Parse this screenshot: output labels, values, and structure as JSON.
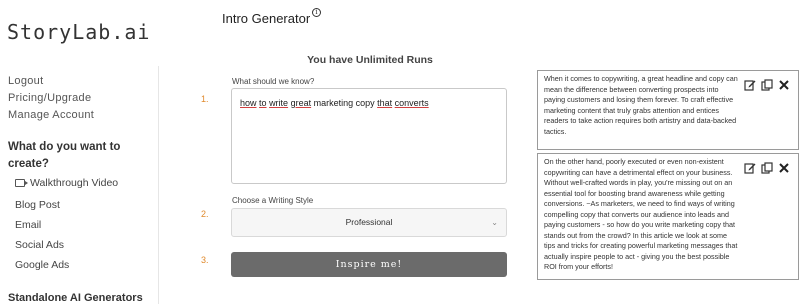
{
  "app": {
    "logo": "StoryLab.ai"
  },
  "sidebar": {
    "links": [
      "Logout",
      "Pricing/Upgrade",
      "Manage Account"
    ],
    "heading": "What do you want to create?",
    "items": [
      "Walkthrough Video",
      "Blog Post",
      "Email",
      "Social Ads",
      "Google Ads"
    ],
    "bottom_heading": "Standalone AI Generators"
  },
  "header": {
    "title": "Intro Generator",
    "info_icon": "i"
  },
  "runs_banner": "You have Unlimited Runs",
  "form": {
    "step1": "1.",
    "topic_label": "What should we know?",
    "topic_words": [
      "how",
      " ",
      "to",
      " ",
      "write",
      " ",
      "great",
      " marketing copy ",
      "that",
      " ",
      "converts"
    ],
    "step2": "2.",
    "style_label": "Choose a Writing Style",
    "style_value": "Professional",
    "step3": "3.",
    "submit_label": "Inspire me!"
  },
  "outputs": [
    {
      "text": "When it comes to copywriting, a great headline and copy can mean the difference between converting prospects into paying customers and losing them forever. To craft effective marketing content that truly grabs attention and entices readers to take action requires both artistry and data-backed tactics."
    },
    {
      "text": "On the other hand, poorly executed or even non-existent copywriting can have a detrimental effect on your business. Without well-crafted words in play, you're missing out on an essential tool for boosting brand awareness while getting conversions. ~As marketers, we need to find ways of writing compelling copy that converts our audience into leads and paying customers - so how do you write marketing copy that stands out from the crowd? In this article we look at some tips and tricks for creating powerful marketing messages that actually inspire people to act - giving you the best possible ROI from your efforts!"
    }
  ],
  "colors": {
    "accent_step": "#e08a2c",
    "button_bg": "#6b6b6b"
  },
  "icons": [
    "edit-icon",
    "copy-icon",
    "close-icon"
  ]
}
